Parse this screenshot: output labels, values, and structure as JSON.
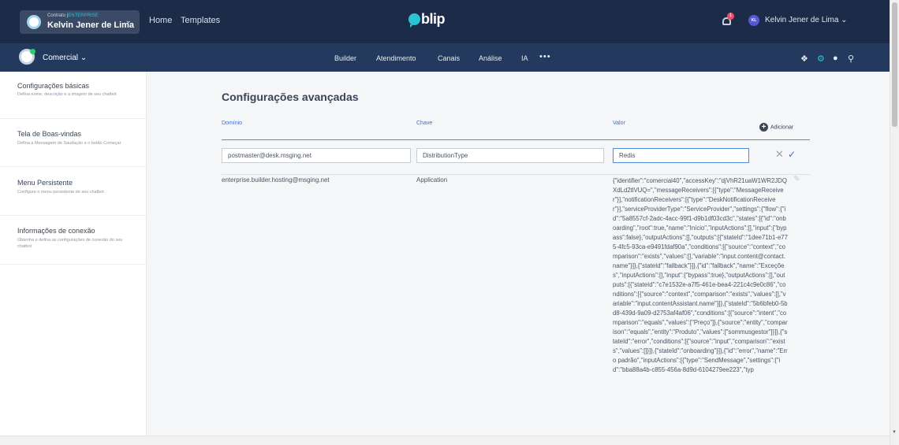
{
  "topbar": {
    "contract_label": "Contrato |",
    "contract_tier": "ENTERPRISE",
    "contract_name": "Kelvin Jener de Lima",
    "links": [
      "Home",
      "Templates"
    ],
    "logo_text": "blip",
    "notification_count": "1",
    "user_initials": "KL",
    "user_name": "Kelvin Jener de Lima",
    "colors": {
      "background": "#1b2b48",
      "accent": "#2cc3d5",
      "badge": "#f24b6a"
    }
  },
  "subbar": {
    "bot_name": "Comercial",
    "nav": [
      "Builder",
      "Atendimento",
      "Canais",
      "Análise",
      "IA"
    ],
    "more": "•••",
    "icons": [
      "puzzle-icon",
      "gear-icon",
      "users-icon",
      "accessibility-icon"
    ]
  },
  "sidebar": {
    "items": [
      {
        "title": "Configurações básicas",
        "desc": "Defina nome, descrição e a imagem de seu chatbot"
      },
      {
        "title": "Tela de Boas-vindas",
        "desc": "Defina a Mensagem de Saudação e o botão Começar"
      },
      {
        "title": "Menu Persistente",
        "desc": "Configure o menu persistente de seu chatbot"
      },
      {
        "title": "Informações de conexão",
        "desc": "Obtenha e defina as configurações de conexão do seu chatbot"
      }
    ]
  },
  "main": {
    "title": "Configurações avançadas",
    "columns": {
      "domain": "Domínio",
      "key": "Chave",
      "value": "Valor"
    },
    "add_label": "Adicionar",
    "edit_row": {
      "domain": "postmaster@desk.msging.net",
      "key": "DistributionType",
      "value": "Redis"
    },
    "rows": [
      {
        "domain": "enterprise.builder.hosting@msging.net",
        "key": "Application",
        "value": "{\"identifier\":\"comercial40\",\"accessKey\":\"djVhR21uaW1WR2JDQXdLd2tlVUQ=\",\"messageReceivers\":[{\"type\":\"MessageReceiver\"}],\"notificationReceivers\":[{\"type\":\"DeskNotificationReceiver\"}],\"serviceProviderType\":\"ServiceProvider\",\"settings\":{\"flow\":{\"id\":\"5a8557cf-2adc-4acc-99f1-d9b1df03cd3c\",\"states\":[{\"id\":\"onboarding\",\"root\":true,\"name\":\"Início\",\"inputActions\":[],\"input\":{\"bypass\":false},\"outputActions\":[],\"outputs\":[{\"stateId\":\"1dee71b1-e775-4fc5-93ca-e9491fdaf90a\",\"conditions\":[{\"source\":\"context\",\"comparison\":\"exists\",\"values\":[],\"variable\":\"input.content@contact.name\"}]},{\"stateId\":\"fallback\"}]},{\"id\":\"fallback\",\"name\":\"Exceções\",\"inputActions\":[],\"input\":{\"bypass\":true},\"outputActions\":[],\"outputs\":[{\"stateId\":\"c7e1532e-a7f5-461e-bea4-221c4c9e0c86\",\"conditions\":[{\"source\":\"context\",\"comparison\":\"exists\",\"values\":[],\"variable\":\"input.contentAssistant.name\"}]},{\"stateId\":\"5b6bfeb0-5bd8-439d-9a09-d2753af4af06\",\"conditions\":[{\"source\":\"intent\",\"comparison\":\"equals\",\"values\":[\"Preço\"]},{\"source\":\"entity\",\"comparison\":\"equals\",\"entity\":\"Produto\",\"values\":[\"sommusgestor\"]}]},{\"stateId\":\"error\",\"conditions\":[{\"source\":\"input\",\"comparison\":\"exists\",\"values\":[]}]},{\"stateId\":\"onboarding\"}]},{\"id\":\"error\",\"name\":\"Erro padrão\",\"inputActions\":[{\"type\":\"SendMessage\",\"settings\":{\"id\":\"bba88a4b-c855-456a-8d9d-6104279ee223\",\"typ"
      }
    ]
  }
}
